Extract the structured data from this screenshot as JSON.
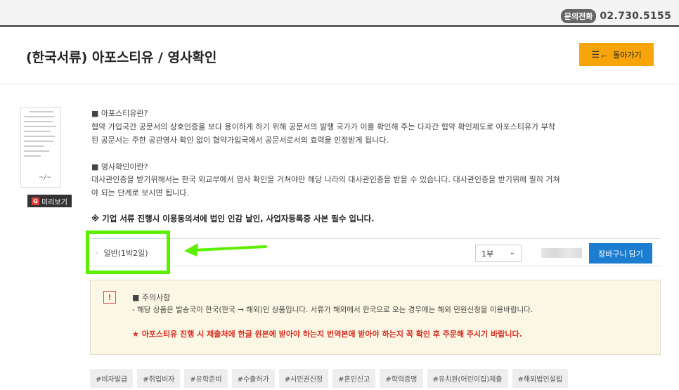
{
  "header": {
    "phone_badge": "문의전화",
    "phone_number": "02.730.5155"
  },
  "page": {
    "title": "(한국서류) 아포스티유 / 영사확인",
    "back_label": "돌아가기"
  },
  "preview": {
    "label": "미리보기"
  },
  "description": {
    "apostille_heading": "■ 아포스티유란?",
    "apostille_line1": "협약 가입국간 공문서의 상호인증을 보다 용이하게 하기 위해 공문서의 발행 국가가 이를 확인해 주는 다자간 협약 확인제도로 아포스티유가 부착",
    "apostille_line2": "된 공문서는 주한 공관영사 확인 없이 협약가입국에서 공문서로서의 효력을 인정받게 됩니다.",
    "consul_heading": "■ 영사확인이란?",
    "consul_line1": "대사관인증을 받기위해서는 한국 외교부에서 영사 확인을 거쳐야만 해당 나라의 대사관인증을 받을 수 있습니다. 대사관인증을 받기위해 필히 거쳐",
    "consul_line2": "야 되는 단계로 보시면 됩니다.",
    "notice": "※ 기업 서류 진행시 이용동의서에 법인 인감 날인, 사업자등록증 사본 필수 입니다."
  },
  "option": {
    "dot": "·",
    "label": "일반(1박2일)",
    "quantity": "1부",
    "cart_label": "장바구니 담기"
  },
  "caution": {
    "icon": "!",
    "title": "■ 주의사항",
    "text": "- 해당 상품은 발송국이 한국(한국 → 해외)인 상품입니다. 서류가 해외에서 한국으로 오는 경우에는 해외 민원신청을 이용바랍니다.",
    "red_text": "★ 아포스티유 진행 시 제출처에 한글 원본에 받아야 하는지 번역본에 받아야 하는지 꼭 확인 후 주문해 주시기 바랍니다."
  },
  "tags": [
    "#비자발급",
    "#취업비자",
    "#유학준비",
    "#수출허가",
    "#시민권신청",
    "#혼인신고",
    "#학력증명",
    "#유치원(어린이집)제출",
    "#해외법인설립"
  ],
  "colors": {
    "accent_orange": "#f8a50c",
    "cart_blue": "#1c7ccf",
    "highlight_green": "#5cf000",
    "warning_red": "#d62f23"
  }
}
